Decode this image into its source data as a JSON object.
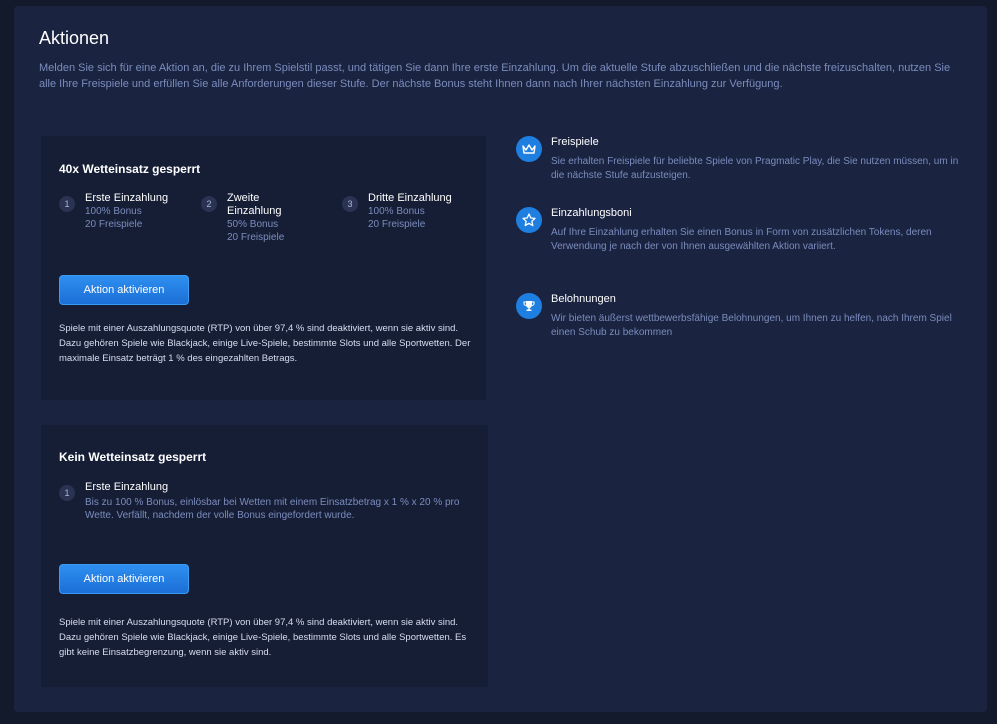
{
  "page": {
    "title": "Aktionen",
    "intro": "Melden Sie sich für eine Aktion an, die zu Ihrem Spielstil passt, und tätigen Sie dann Ihre erste Einzahlung. Um die aktuelle Stufe abzuschließen und die nächste freizuschalten, nutzen Sie alle Ihre Freispiele und erfüllen Sie alle Anforderungen dieser Stufe. Der nächste Bonus steht Ihnen dann nach Ihrer nächsten Einzahlung zur Verfügung."
  },
  "card1": {
    "title": "40x Wetteinsatz gesperrt",
    "steps": [
      {
        "num": "1",
        "title": "Erste Einzahlung",
        "lines": [
          "100% Bonus",
          "20 Freispiele"
        ]
      },
      {
        "num": "2",
        "title": "Zweite Einzahlung",
        "lines": [
          "50% Bonus",
          "20 Freispiele"
        ]
      },
      {
        "num": "3",
        "title": "Dritte Einzahlung",
        "lines": [
          "100% Bonus",
          "20 Freispiele"
        ]
      }
    ],
    "button": "Aktion aktivieren",
    "note": "Spiele mit einer Auszahlungsquote (RTP) von über 97,4 % sind deaktiviert, wenn sie aktiv sind. Dazu gehören Spiele wie Blackjack, einige Live-Spiele, bestimmte Slots und alle Sportwetten. Der maximale Einsatz beträgt 1 % des eingezahlten Betrags."
  },
  "card2": {
    "title": "Kein Wetteinsatz gesperrt",
    "step": {
      "num": "1",
      "title": "Erste Einzahlung",
      "desc": "Bis zu 100 % Bonus, einlösbar bei Wetten mit einem Einsatzbetrag x 1 % x 20 % pro Wette. Verfällt, nachdem der volle Bonus eingefordert wurde."
    },
    "button": "Aktion aktivieren",
    "note": "Spiele mit einer Auszahlungsquote (RTP) von über 97,4 % sind deaktiviert, wenn sie aktiv sind. Dazu gehören Spiele wie Blackjack, einige Live-Spiele, bestimmte Slots und alle Sportwetten. Es gibt keine Einsatzbegrenzung, wenn sie aktiv sind."
  },
  "features": [
    {
      "icon": "crown-icon",
      "title": "Freispiele",
      "desc": "Sie erhalten Freispiele für beliebte Spiele von Pragmatic Play, die Sie nutzen müssen, um in die nächste Stufe aufzusteigen."
    },
    {
      "icon": "star-icon",
      "title": "Einzahlungsboni",
      "desc": "Auf Ihre Einzahlung erhalten Sie einen Bonus in Form von zusätzlichen Tokens, deren Verwendung je nach der von Ihnen ausgewählten Aktion variiert."
    },
    {
      "icon": "trophy-icon",
      "title": "Belohnungen",
      "desc": "Wir bieten äußerst wettbewerbsfähige Belohnungen, um Ihnen zu helfen, nach Ihrem Spiel einen Schub zu bekommen"
    }
  ],
  "colors": {
    "background": "#121a2c",
    "panel": "#1a2340",
    "card": "#161e36",
    "accent": "#1f7fe0",
    "muted_text": "#7b8cbd"
  }
}
